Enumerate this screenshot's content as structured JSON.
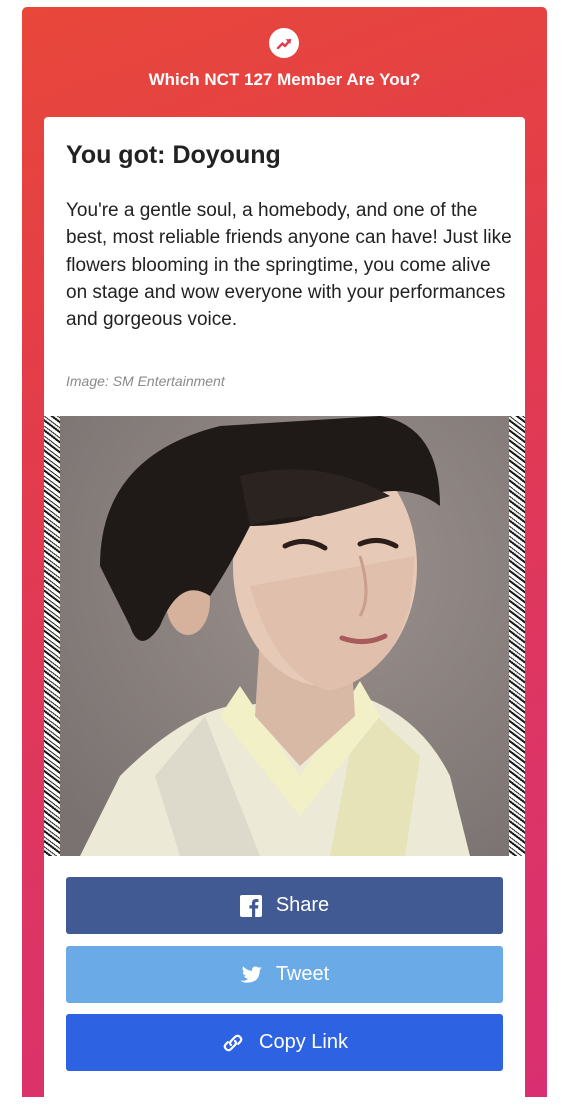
{
  "quiz": {
    "title": "Which NCT 127 Member Are You?"
  },
  "result": {
    "heading": "You got: Doyoung",
    "description": "You're a gentle soul, a homebody, and one of the best, most reliable friends anyone can have! Just like flowers blooming in the springtime, you come alive on stage and wow everyone with your performances and gorgeous voice.",
    "image_credit": "Image: SM Entertainment"
  },
  "share": {
    "facebook_label": "Share",
    "twitter_label": "Tweet",
    "copy_label": "Copy Link"
  },
  "icons": {
    "badge": "trending-icon",
    "facebook": "facebook-icon",
    "twitter": "twitter-icon",
    "copy": "link-icon"
  },
  "colors": {
    "card_gradient_start": "#e8473a",
    "card_gradient_end": "#d92f70",
    "facebook": "#415a93",
    "twitter": "#6aaae6",
    "copy_link": "#2d62e2"
  }
}
